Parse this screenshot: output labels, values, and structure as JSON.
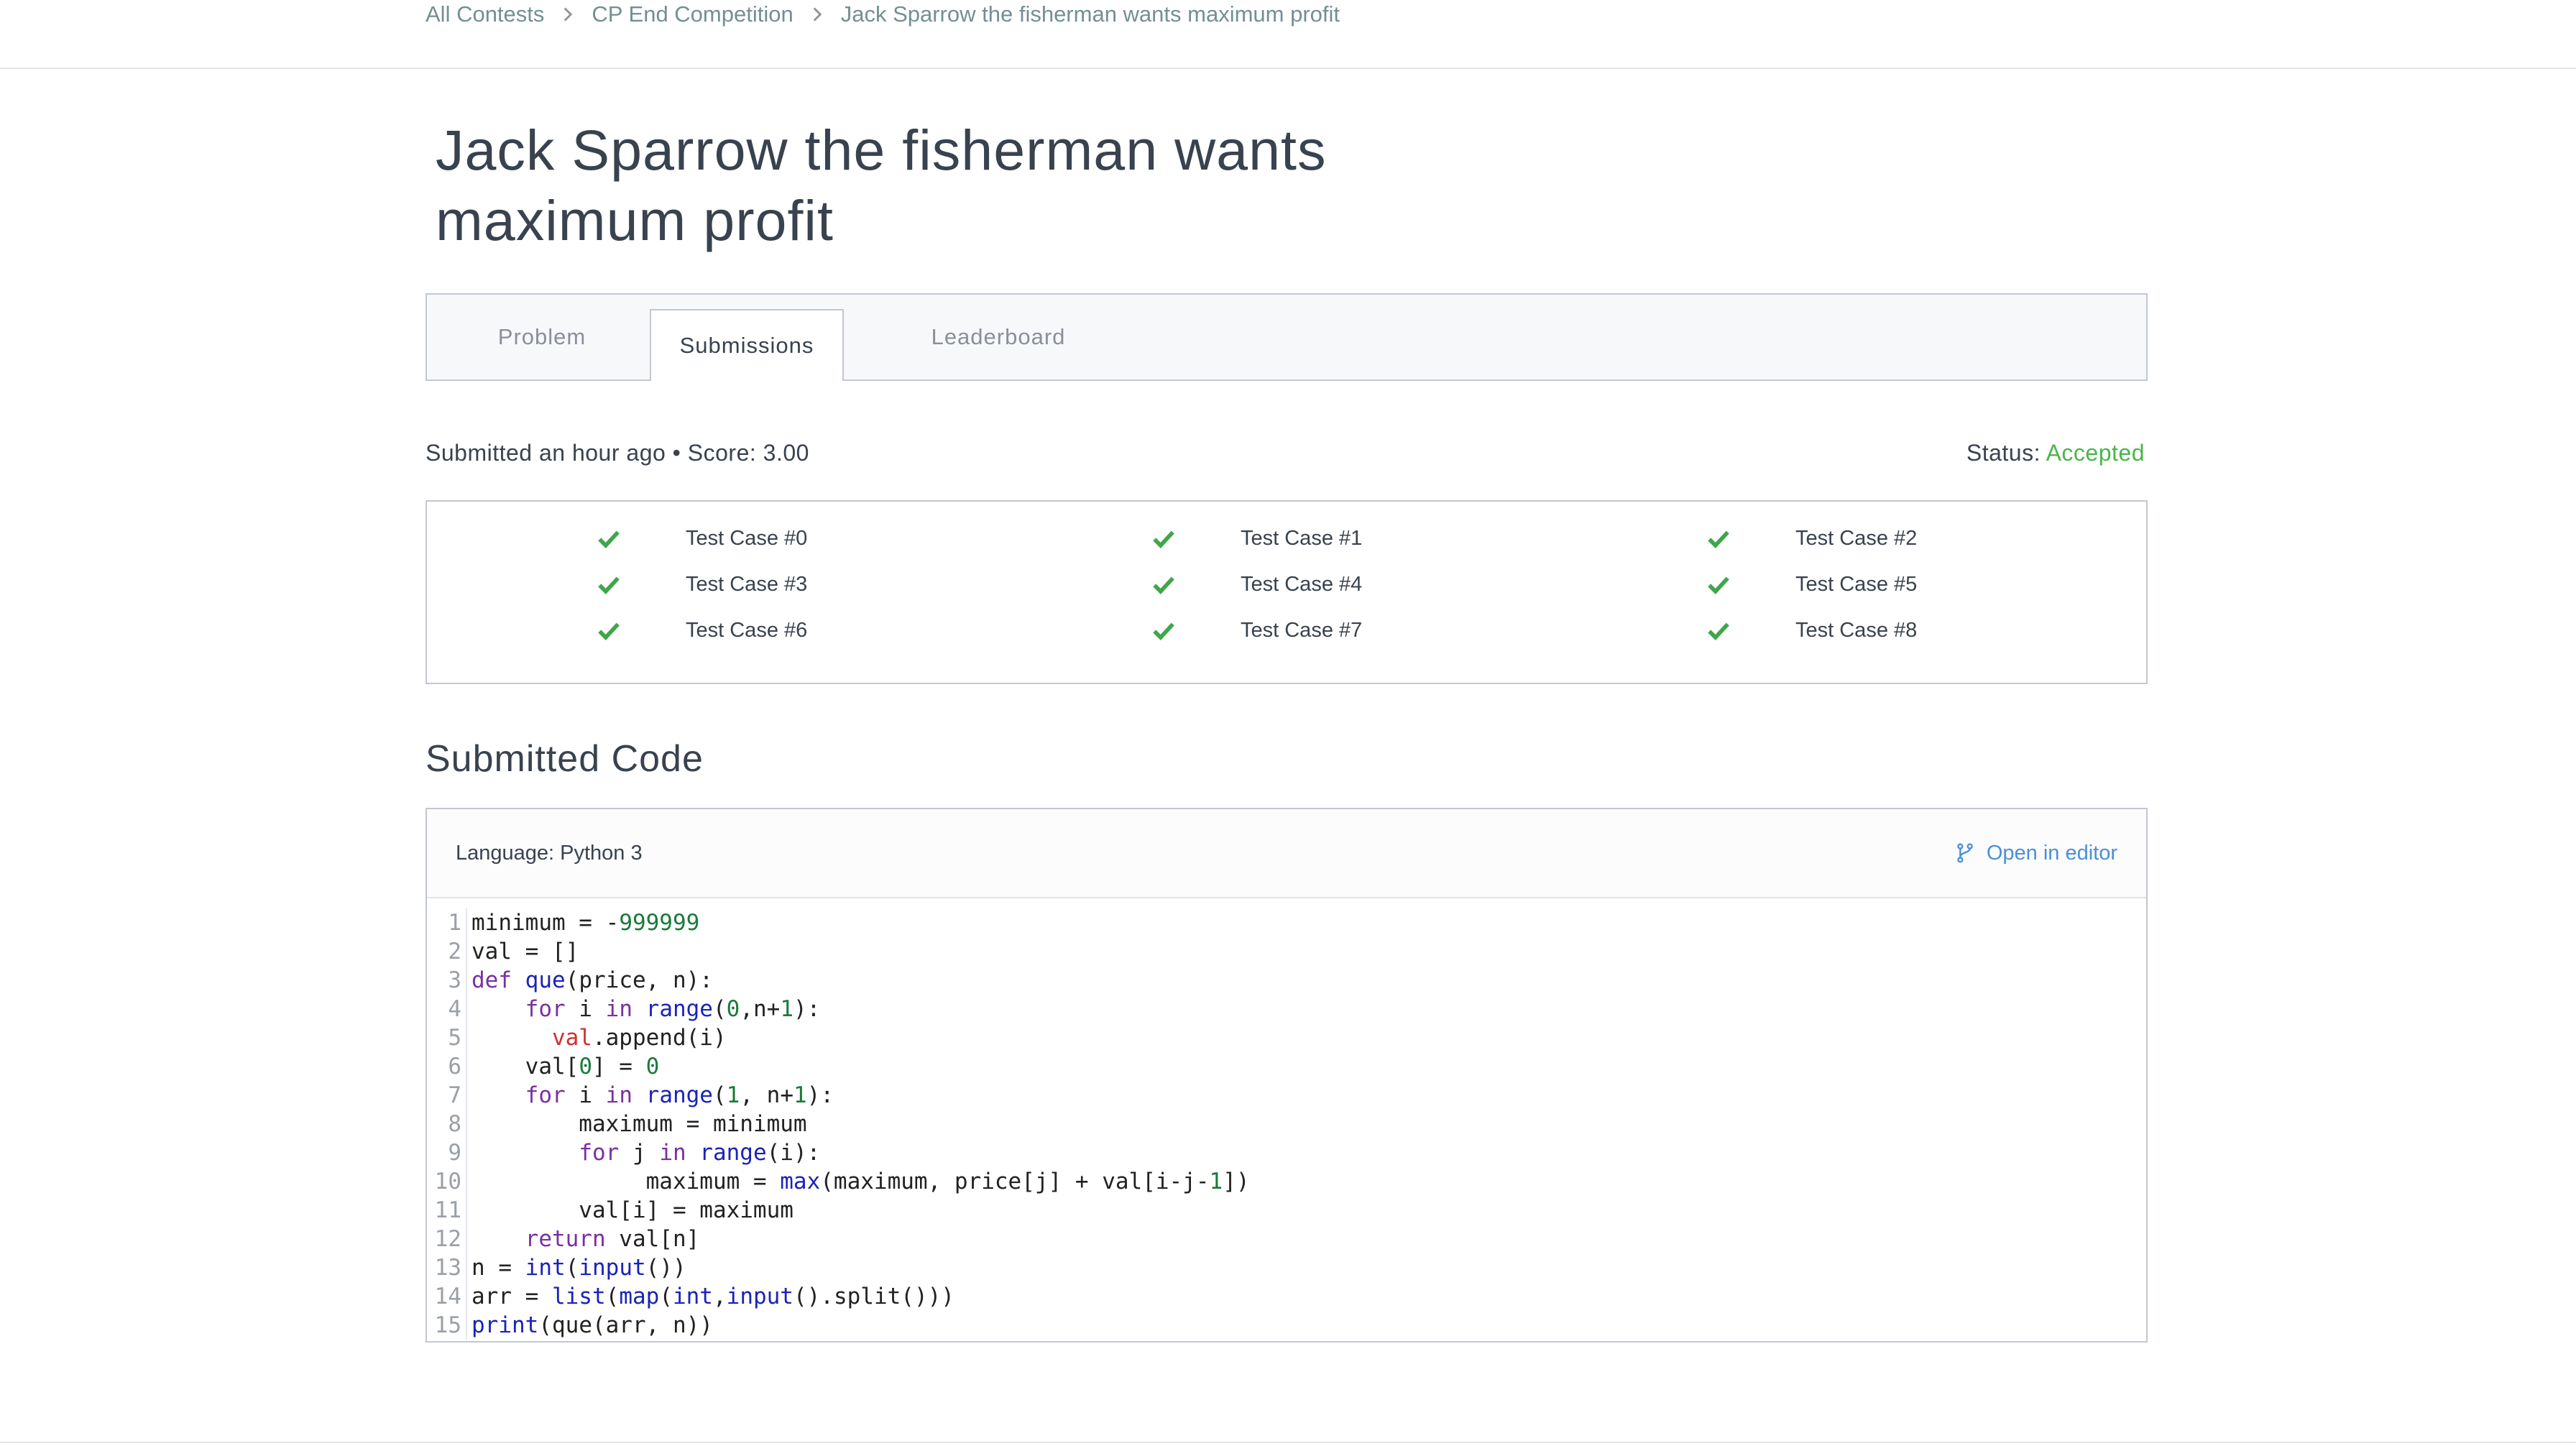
{
  "breadcrumb": {
    "items": [
      "All Contests",
      "CP End Competition",
      "Jack Sparrow the fisherman wants maximum profit"
    ]
  },
  "challenge": {
    "title_line1": "Jack Sparrow the fisherman wants",
    "title_line2": "maximum profit"
  },
  "tabs": [
    {
      "label": "Problem",
      "active": false
    },
    {
      "label": "Submissions",
      "active": true
    },
    {
      "label": "Leaderboard",
      "active": false
    }
  ],
  "submission": {
    "meta": "Submitted an hour ago • Score: 3.00",
    "status_label": "Status:",
    "status_value": "Accepted",
    "status_color": "#4bb54b"
  },
  "test_cases": [
    "Test Case #0",
    "Test Case #1",
    "Test Case #2",
    "Test Case #3",
    "Test Case #4",
    "Test Case #5",
    "Test Case #6",
    "Test Case #7",
    "Test Case #8"
  ],
  "code_section": {
    "title": "Submitted Code",
    "language": "Language: Python 3",
    "open_editor": "Open in editor",
    "line_numbers": [
      "1",
      "2",
      "3",
      "4",
      "5",
      "6",
      "7",
      "8",
      "9",
      "10",
      "11",
      "12",
      "13",
      "14",
      "15"
    ]
  },
  "icons": {
    "breadcrumb_separator": "chevron-right-icon",
    "test_pass": "checkmark-icon",
    "open_editor": "git-branch-icon"
  },
  "colors": {
    "accent_link": "#4a8fd8",
    "success": "#4bb54b"
  }
}
